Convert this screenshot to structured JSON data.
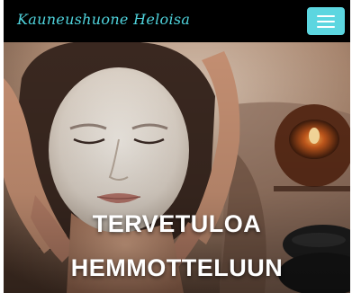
{
  "navbar": {
    "brand": "Kauneushuone Heloisa",
    "menu_icon": "hamburger-menu-icon",
    "accent_color": "#5cd6e0"
  },
  "hero": {
    "image": "spa-facial-treatment-photo",
    "title_line1": "TERVETULOA",
    "title_line2": "HEMMOTTELUUN"
  }
}
